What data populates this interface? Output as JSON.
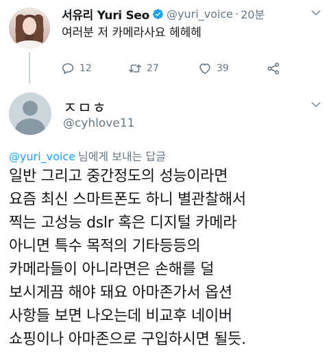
{
  "parent_tweet": {
    "display_name": "서유리 Yuri Seo",
    "handle": "@yuri_voice",
    "separator": "·",
    "time": "20분",
    "text": "여러분 저 카메라사요 헤헤헤",
    "actions": {
      "reply_count": "12",
      "retweet_count": "27",
      "like_count": "39"
    }
  },
  "reply_tweet": {
    "display_name": "ㅈㅁㅎ",
    "handle": "@cyhlove11",
    "reply_to": {
      "mention": "@yuri_voice",
      "suffix": "님에게 보내는 답글"
    },
    "text_lines": [
      "일반 그리고 중간정도의 성능이라면",
      "요즘 최신 스마트폰도 하니 별관찰해서",
      "찍는 고성능 dslr 혹은 디지털 카메라",
      "아니면 특수 목적의 기타등등의",
      "카메라들이 아니라면은 손해를 덜",
      "보시게끔 해야 돼요 아마존가서 옵션",
      "사항들 보면 나오는데 비교후 네이버",
      "쇼핑이나 아마존으로 구입하시면 될듯."
    ]
  },
  "colors": {
    "verified_blue": "#1da1f2",
    "secondary_text": "#657786",
    "primary_text": "#14171a",
    "thread_line": "#ccd6dd"
  }
}
